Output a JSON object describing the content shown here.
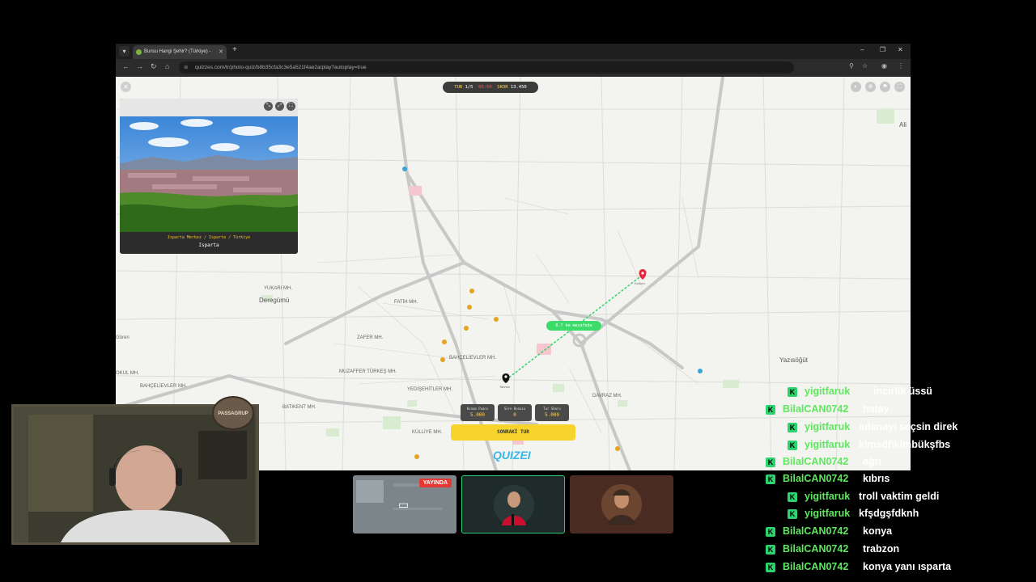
{
  "browser": {
    "tab_title": "Bunsu Hangi Şehir? (Türkiye) - ",
    "url": "quizzes.com/tr/photo-quiz/b8b35cfa3c3e5a521f4ae2a/play?autoplay=true"
  },
  "game": {
    "hud": {
      "round_label": "TUR",
      "round_value": "1/5",
      "red_text": "00:00",
      "score_label": "SKOR",
      "score_value": "13.450"
    },
    "photo": {
      "subtitle": "Isparta Merkez / Isparta / Türkiye",
      "city": "Isparta"
    },
    "distance_pill": "0.7 km mesafede",
    "scores": [
      {
        "label": "Konum Puanı",
        "value": "5.000"
      },
      {
        "label": "Süre Bonusu",
        "value": "0"
      },
      {
        "label": "Tur Skoru",
        "value": "5.000"
      }
    ],
    "next_button": "SONRAKİ TUR",
    "logo": "QUIZEI",
    "map_labels": {
      "yukari": "YUKARI MH.",
      "deregumu": "Deregümü",
      "fatih": "FATİH MH.",
      "zafer": "ZAFER MH.",
      "bahcelievler": "BAHÇELİEVLER MH.",
      "muzaffer": "MUZAFFER TÜRKEŞ MH.",
      "yediler": "YEDİŞEHİTLER MH.",
      "batikent": "BATIKENT MH.",
      "kulliye": "KÜLLİYE MH.",
      "davraz": "DAVRAZ MH.",
      "yazisogut": "Yazısöğüt",
      "goren": "Gören",
      "okul": "OKUL MH.",
      "bahce2": "BAHÇELİEVLER MH.",
      "ali": "Ali",
      "guess_label": "Tahmin",
      "answer_label": "Konum"
    }
  },
  "webcam": {
    "badge_text": "PASSAGRUP"
  },
  "stream": {
    "live_label": "YAYINDA"
  },
  "chat": [
    {
      "user": "yigitfaruk",
      "message": "incirlik üssü"
    },
    {
      "user": "BilalCAN0742",
      "message": "hatay"
    },
    {
      "user": "yigitfaruk",
      "message": "adanayı seçsin direk"
    },
    {
      "user": "yigitfaruk",
      "message": "klmsdfiklmbükşfbs"
    },
    {
      "user": "BilalCAN0742",
      "message": "ağrı"
    },
    {
      "user": "BilalCAN0742",
      "message": "kıbrıs"
    },
    {
      "user": "yigitfaruk",
      "message": "troll vaktim geldi"
    },
    {
      "user": "yigitfaruk",
      "message": "kfşdgşfdknh"
    },
    {
      "user": "BilalCAN0742",
      "message": "konya"
    },
    {
      "user": "BilalCAN0742",
      "message": "trabzon"
    },
    {
      "user": "BilalCAN0742",
      "message": "konya yanı ısparta"
    }
  ],
  "colors": {
    "chat_user": "#5ee85e",
    "badge": "#2dd36f",
    "pill": "#3ddc6a",
    "button": "#f6d32d",
    "live": "#e53935"
  }
}
